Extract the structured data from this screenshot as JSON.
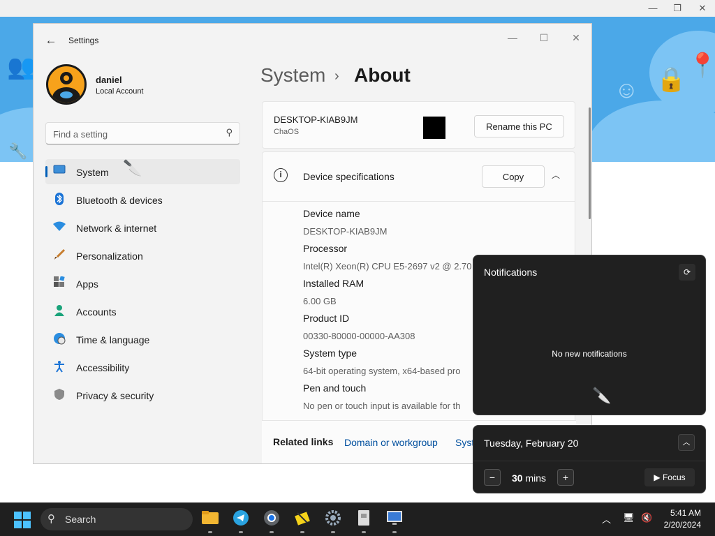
{
  "window": {
    "title": "Settings",
    "back_icon": "arrow-left-icon",
    "minimize_icon": "minimize-icon",
    "maximize_icon": "maximize-icon",
    "close_icon": "close-icon"
  },
  "user": {
    "name": "daniel",
    "account_type": "Local Account"
  },
  "search": {
    "placeholder": "Find a setting"
  },
  "sidebar": {
    "items": [
      {
        "label": "System",
        "icon": "monitor-icon",
        "active": true
      },
      {
        "label": "Bluetooth & devices",
        "icon": "bluetooth-icon"
      },
      {
        "label": "Network & internet",
        "icon": "wifi-icon"
      },
      {
        "label": "Personalization",
        "icon": "brush-icon"
      },
      {
        "label": "Apps",
        "icon": "apps-icon"
      },
      {
        "label": "Accounts",
        "icon": "person-icon"
      },
      {
        "label": "Time & language",
        "icon": "globe-clock-icon"
      },
      {
        "label": "Accessibility",
        "icon": "accessibility-icon"
      },
      {
        "label": "Privacy & security",
        "icon": "shield-icon"
      }
    ]
  },
  "breadcrumb": {
    "parent": "System",
    "separator": "›",
    "current": "About"
  },
  "pc_card": {
    "name": "DESKTOP-KIAB9JM",
    "subtitle": "ChaOS",
    "rename_label": "Rename this PC"
  },
  "specs": {
    "title": "Device specifications",
    "copy_label": "Copy",
    "items": [
      {
        "label": "Device name",
        "value": "DESKTOP-KIAB9JM"
      },
      {
        "label": "Processor",
        "value": "Intel(R) Xeon(R) CPU E5-2697 v2 @ 2.70"
      },
      {
        "label": "Installed RAM",
        "value": "6.00 GB"
      },
      {
        "label": "Product ID",
        "value": "00330-80000-00000-AA308"
      },
      {
        "label": "System type",
        "value": "64-bit operating system, x64-based pro"
      },
      {
        "label": "Pen and touch",
        "value": "No pen or touch input is available for th"
      }
    ]
  },
  "related": {
    "title": "Related links",
    "links": [
      "Domain or workgroup",
      "Syst"
    ]
  },
  "notifications": {
    "title": "Notifications",
    "empty": "No new notifications"
  },
  "calendar": {
    "date": "Tuesday, February 20",
    "focus_minutes": "30",
    "focus_unit": "mins",
    "minus": "−",
    "plus": "+",
    "focus_label": "Focus"
  },
  "taskbar": {
    "search_label": "Search",
    "apps": [
      "file-explorer-icon",
      "telegram-icon",
      "chrome-icon",
      "paint-app-icon",
      "settings-gear-icon",
      "archive-icon",
      "monitor-app-icon"
    ],
    "time": "5:41 AM",
    "date": "2/20/2024"
  }
}
